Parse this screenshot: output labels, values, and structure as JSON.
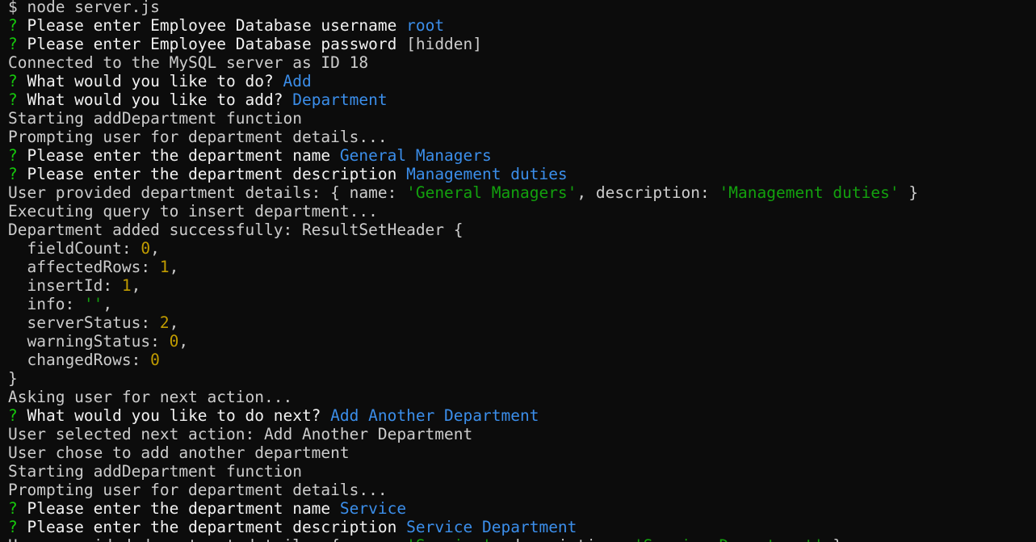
{
  "colors": {
    "background": "#0c0c0c",
    "text": "#cccccc",
    "prompt_marker": "#16c60c",
    "answer": "#3b8eea",
    "string": "#13a10e",
    "number": "#c19c00"
  },
  "terminal": {
    "lines": [
      [
        {
          "t": "$ node server.js",
          "c": "plain"
        }
      ],
      [
        {
          "t": "? ",
          "c": "prompt-q"
        },
        {
          "t": "Please enter Employee Database username ",
          "c": "bright"
        },
        {
          "t": "root",
          "c": "answer"
        }
      ],
      [
        {
          "t": "? ",
          "c": "prompt-q"
        },
        {
          "t": "Please enter Employee Database password ",
          "c": "bright"
        },
        {
          "t": "[hidden]",
          "c": "plain"
        }
      ],
      [
        {
          "t": "Connected to the MySQL server as ID 18",
          "c": "plain"
        }
      ],
      [
        {
          "t": "? ",
          "c": "prompt-q"
        },
        {
          "t": "What would you like to do? ",
          "c": "bright"
        },
        {
          "t": "Add",
          "c": "answer"
        }
      ],
      [
        {
          "t": "? ",
          "c": "prompt-q"
        },
        {
          "t": "What would you like to add? ",
          "c": "bright"
        },
        {
          "t": "Department",
          "c": "answer"
        }
      ],
      [
        {
          "t": "Starting addDepartment function",
          "c": "plain"
        }
      ],
      [
        {
          "t": "Prompting user for department details...",
          "c": "plain"
        }
      ],
      [
        {
          "t": "? ",
          "c": "prompt-q"
        },
        {
          "t": "Please enter the department name ",
          "c": "bright"
        },
        {
          "t": "General Managers",
          "c": "answer"
        }
      ],
      [
        {
          "t": "? ",
          "c": "prompt-q"
        },
        {
          "t": "Please enter the department description ",
          "c": "bright"
        },
        {
          "t": "Management duties",
          "c": "answer"
        }
      ],
      [
        {
          "t": "User provided department details: { name: ",
          "c": "plain"
        },
        {
          "t": "'General Managers'",
          "c": "string"
        },
        {
          "t": ", description: ",
          "c": "plain"
        },
        {
          "t": "'Management duties'",
          "c": "string"
        },
        {
          "t": " }",
          "c": "plain"
        }
      ],
      [
        {
          "t": "Executing query to insert department...",
          "c": "plain"
        }
      ],
      [
        {
          "t": "Department added successfully: ResultSetHeader {",
          "c": "plain"
        }
      ],
      [
        {
          "t": "  fieldCount: ",
          "c": "plain"
        },
        {
          "t": "0",
          "c": "number"
        },
        {
          "t": ",",
          "c": "plain"
        }
      ],
      [
        {
          "t": "  affectedRows: ",
          "c": "plain"
        },
        {
          "t": "1",
          "c": "number"
        },
        {
          "t": ",",
          "c": "plain"
        }
      ],
      [
        {
          "t": "  insertId: ",
          "c": "plain"
        },
        {
          "t": "1",
          "c": "number"
        },
        {
          "t": ",",
          "c": "plain"
        }
      ],
      [
        {
          "t": "  info: ",
          "c": "plain"
        },
        {
          "t": "''",
          "c": "string"
        },
        {
          "t": ",",
          "c": "plain"
        }
      ],
      [
        {
          "t": "  serverStatus: ",
          "c": "plain"
        },
        {
          "t": "2",
          "c": "number"
        },
        {
          "t": ",",
          "c": "plain"
        }
      ],
      [
        {
          "t": "  warningStatus: ",
          "c": "plain"
        },
        {
          "t": "0",
          "c": "number"
        },
        {
          "t": ",",
          "c": "plain"
        }
      ],
      [
        {
          "t": "  changedRows: ",
          "c": "plain"
        },
        {
          "t": "0",
          "c": "number"
        }
      ],
      [
        {
          "t": "}",
          "c": "plain"
        }
      ],
      [
        {
          "t": "Asking user for next action...",
          "c": "plain"
        }
      ],
      [
        {
          "t": "? ",
          "c": "prompt-q"
        },
        {
          "t": "What would you like to do next? ",
          "c": "bright"
        },
        {
          "t": "Add Another Department",
          "c": "answer"
        }
      ],
      [
        {
          "t": "User selected next action: Add Another Department",
          "c": "plain"
        }
      ],
      [
        {
          "t": "User chose to add another department",
          "c": "plain"
        }
      ],
      [
        {
          "t": "Starting addDepartment function",
          "c": "plain"
        }
      ],
      [
        {
          "t": "Prompting user for department details...",
          "c": "plain"
        }
      ],
      [
        {
          "t": "? ",
          "c": "prompt-q"
        },
        {
          "t": "Please enter the department name ",
          "c": "bright"
        },
        {
          "t": "Service",
          "c": "answer"
        }
      ],
      [
        {
          "t": "? ",
          "c": "prompt-q"
        },
        {
          "t": "Please enter the department description ",
          "c": "bright"
        },
        {
          "t": "Service Department",
          "c": "answer"
        }
      ],
      [
        {
          "t": "User provided department details: { name: ",
          "c": "plain"
        },
        {
          "t": "'Service'",
          "c": "string"
        },
        {
          "t": ", description: ",
          "c": "plain"
        },
        {
          "t": "'Service Department'",
          "c": "string"
        },
        {
          "t": " }",
          "c": "plain"
        }
      ]
    ]
  }
}
